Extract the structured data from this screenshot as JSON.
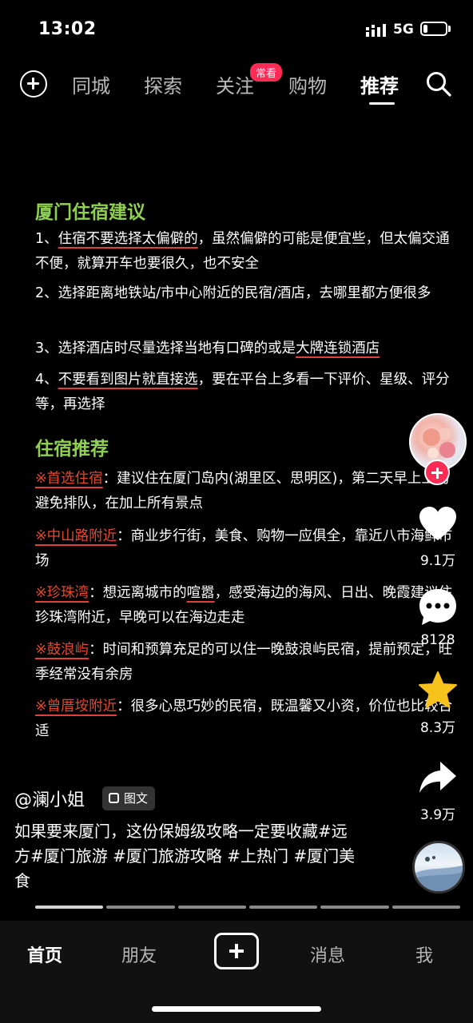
{
  "status_bar": {
    "time": "13:02",
    "network": "5G",
    "battery_level": 0.2
  },
  "top_nav": {
    "tabs": [
      {
        "label": "同城"
      },
      {
        "label": "探索"
      },
      {
        "label": "关注",
        "badge": "常看"
      },
      {
        "label": "购物"
      },
      {
        "label": "推荐",
        "active": true
      }
    ],
    "icons": [
      "add-icon",
      "search-icon"
    ]
  },
  "post": {
    "section1_title": "厦门住宿建议",
    "section1_items": [
      {
        "num": "1、",
        "hl": "住宿不要选择太偏僻的",
        "rest": "，虽然偏僻的可能是便宜些，但太偏交通不便，就算开车也要很久，也不安全"
      },
      {
        "num": "2、",
        "hl": "",
        "rest": "选择距离地铁站/市中心附近的民宿/酒店，去哪里都方便很多"
      },
      {
        "num": "3、",
        "pre": "选择酒店时尽量选择当地有口碑的或是",
        "hl": "大牌连锁酒店",
        "rest": ""
      },
      {
        "num": "4、",
        "hl": "不要看到图片就直接选",
        "rest": "，要在平台上多看一下评价、星级、评分等，再选择"
      }
    ],
    "section2_title": "住宿推荐",
    "section2_items": [
      {
        "mark": "※",
        "place": "首选住宿",
        "text": "：建议住在厦门岛内(湖里区、思明区)，第二天早上上岛避免排队，在加上所有景点"
      },
      {
        "mark": "※",
        "place": "中山路附近",
        "text": "：商业步行街，美食、购物一应俱全，靠近八市海鲜市场"
      },
      {
        "mark": "※",
        "place": "珍珠湾",
        "text": "：想远离城市的",
        "text_hl": "喧嚣",
        "text2": "，感受海边的海风、日出、晚霞建议住珍珠湾附近，早晚可以在海边走走"
      },
      {
        "mark": "※",
        "place": "鼓浪屿",
        "text": "：时间和预算充足的可以住一晚鼓浪屿民宿，提前预定，旺季经常没有余房"
      },
      {
        "mark": "※",
        "place": "曾厝垵附近",
        "text": "：很多心思巧妙的民宿，既温馨又小资，价位也比较合适"
      }
    ]
  },
  "rail": {
    "likes": "9.1万",
    "comments": "8128",
    "favorites": "8.3万",
    "shares": "3.9万"
  },
  "author": {
    "name": "@澜小姐",
    "type_tag": "图文"
  },
  "caption": "如果要来厦门，这份保姆级攻略一定要收藏#远方#厦门旅游 #厦门旅游攻略 #上热门 #厦门美食",
  "progress": {
    "pages": 6,
    "current": 1
  },
  "bottom_nav": {
    "home": "首页",
    "friends": "朋友",
    "messages": "消息",
    "me": "我"
  },
  "colors": {
    "accent": "#fe2c55",
    "heading_green": "#8fd14f",
    "underline_red": "#e0403a",
    "star_gold": "#f7c21c"
  }
}
